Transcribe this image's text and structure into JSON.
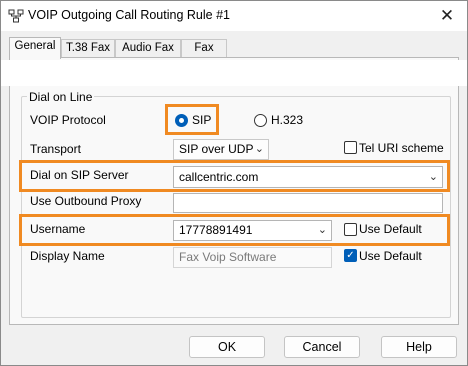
{
  "window": {
    "title": "VOIP Outgoing Call Routing Rule #1",
    "close_glyph": "✕"
  },
  "tabs": [
    {
      "label": "General"
    },
    {
      "label": "T.38 Fax"
    },
    {
      "label": "Audio Fax"
    },
    {
      "label": "Fax"
    }
  ],
  "group": {
    "title": "Dial on Line"
  },
  "voip_protocol": {
    "label": "VOIP Protocol",
    "options": [
      "SIP",
      "H.323"
    ],
    "selected": "SIP"
  },
  "transport": {
    "label": "Transport",
    "value": "SIP over UDP"
  },
  "tel_uri": {
    "label": "Tel URI scheme",
    "checked": false
  },
  "sip_server": {
    "label": "Dial on SIP Server",
    "value": "callcentric.com"
  },
  "outbound_proxy": {
    "label": "Use Outbound Proxy",
    "value": ""
  },
  "username": {
    "label": "Username",
    "value": "17778891491"
  },
  "username_default": {
    "label": "Use Default",
    "checked": false
  },
  "display_name": {
    "label": "Display Name",
    "placeholder": "Fax Voip Software"
  },
  "display_default": {
    "label": "Use Default",
    "checked": true
  },
  "buttons": {
    "ok": "OK",
    "cancel": "Cancel",
    "help": "Help"
  },
  "colors": {
    "highlight": "#f08a22",
    "accent": "#005fb8"
  }
}
